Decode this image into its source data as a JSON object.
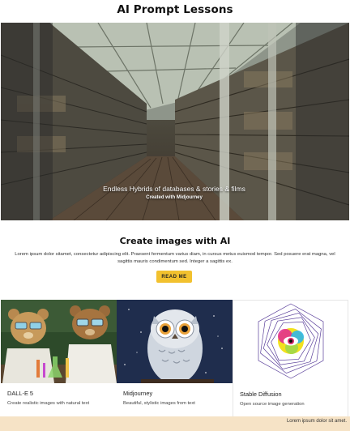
{
  "page": {
    "title": "AI Prompt Lessons"
  },
  "hero": {
    "caption": "Endless Hybrids of databases & stories & films",
    "subcaption": "Created with Midjourney",
    "slide_count": 5
  },
  "section": {
    "title": "Create images with AI",
    "body": "Lorem ipsum dolor sitamet, consectetur adipiscing elit. Praesent fermentum varius diam, in cursus metus euismod tempor. Sed posuere erat magna, vel sagittis mauris condimentum sed. Integer a sagittis ex.",
    "cta_label": "READ ME"
  },
  "cards": [
    {
      "title": "DALL-E 5",
      "description": "Create realistic images with natural text"
    },
    {
      "title": "Midjourney",
      "description": "Beautiful, stylistic images from text"
    },
    {
      "title": "Stable Diffusion",
      "description": "Open source image generation"
    }
  ],
  "footer": {
    "text": "Lorem ipsum dolor sit amet."
  },
  "colors": {
    "accent": "#f2c12e",
    "footer_bg": "#f6e3c6"
  }
}
